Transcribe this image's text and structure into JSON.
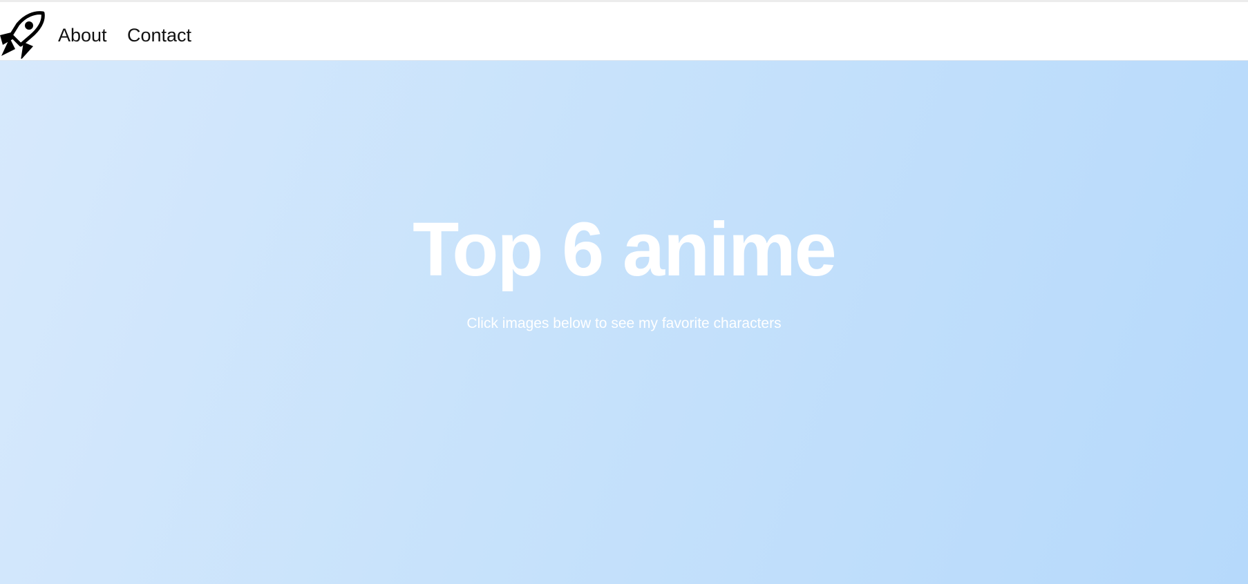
{
  "navbar": {
    "logo_icon": "rocket-icon",
    "links": [
      {
        "label": "About"
      },
      {
        "label": "Contact"
      }
    ]
  },
  "hero": {
    "title": "Top 6 anime",
    "subtitle": "Click images below to see my favorite characters",
    "gradient_colors": [
      "#d7e9fc",
      "#b6d9fb"
    ],
    "text_color": "#ffffff"
  }
}
